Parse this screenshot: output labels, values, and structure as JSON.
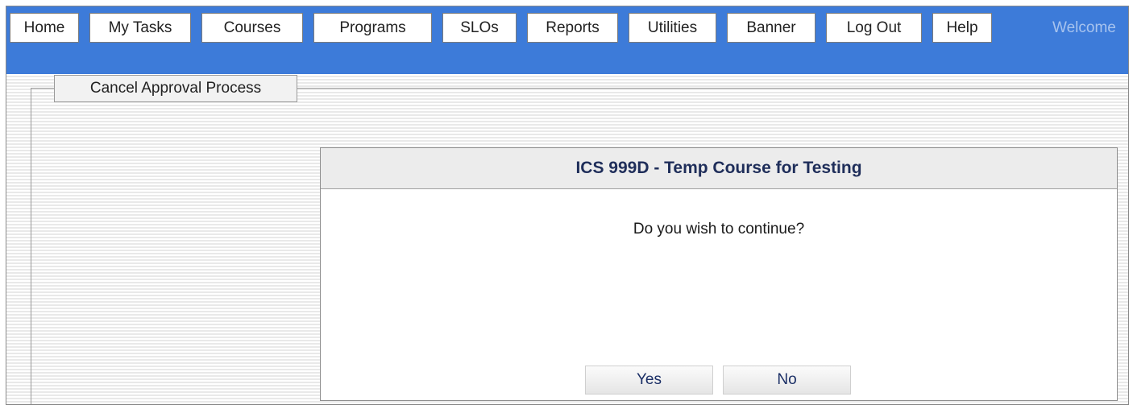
{
  "nav": {
    "items": [
      {
        "label": "Home"
      },
      {
        "label": "My Tasks"
      },
      {
        "label": "Courses"
      },
      {
        "label": "Programs"
      },
      {
        "label": "SLOs"
      },
      {
        "label": "Reports"
      },
      {
        "label": "Utilities"
      },
      {
        "label": "Banner"
      },
      {
        "label": "Log Out"
      },
      {
        "label": "Help"
      }
    ],
    "welcome": "Welcome"
  },
  "group": {
    "button_label": "Cancel Approval Process"
  },
  "dialog": {
    "title": "ICS 999D - Temp Course for Testing",
    "message": "Do you wish to continue?",
    "yes_label": "Yes",
    "no_label": "No"
  },
  "colors": {
    "nav_bar": "#3d7bd9",
    "dialog_title": "#1f2e5a",
    "dialog_button_text": "#1b2f66"
  }
}
